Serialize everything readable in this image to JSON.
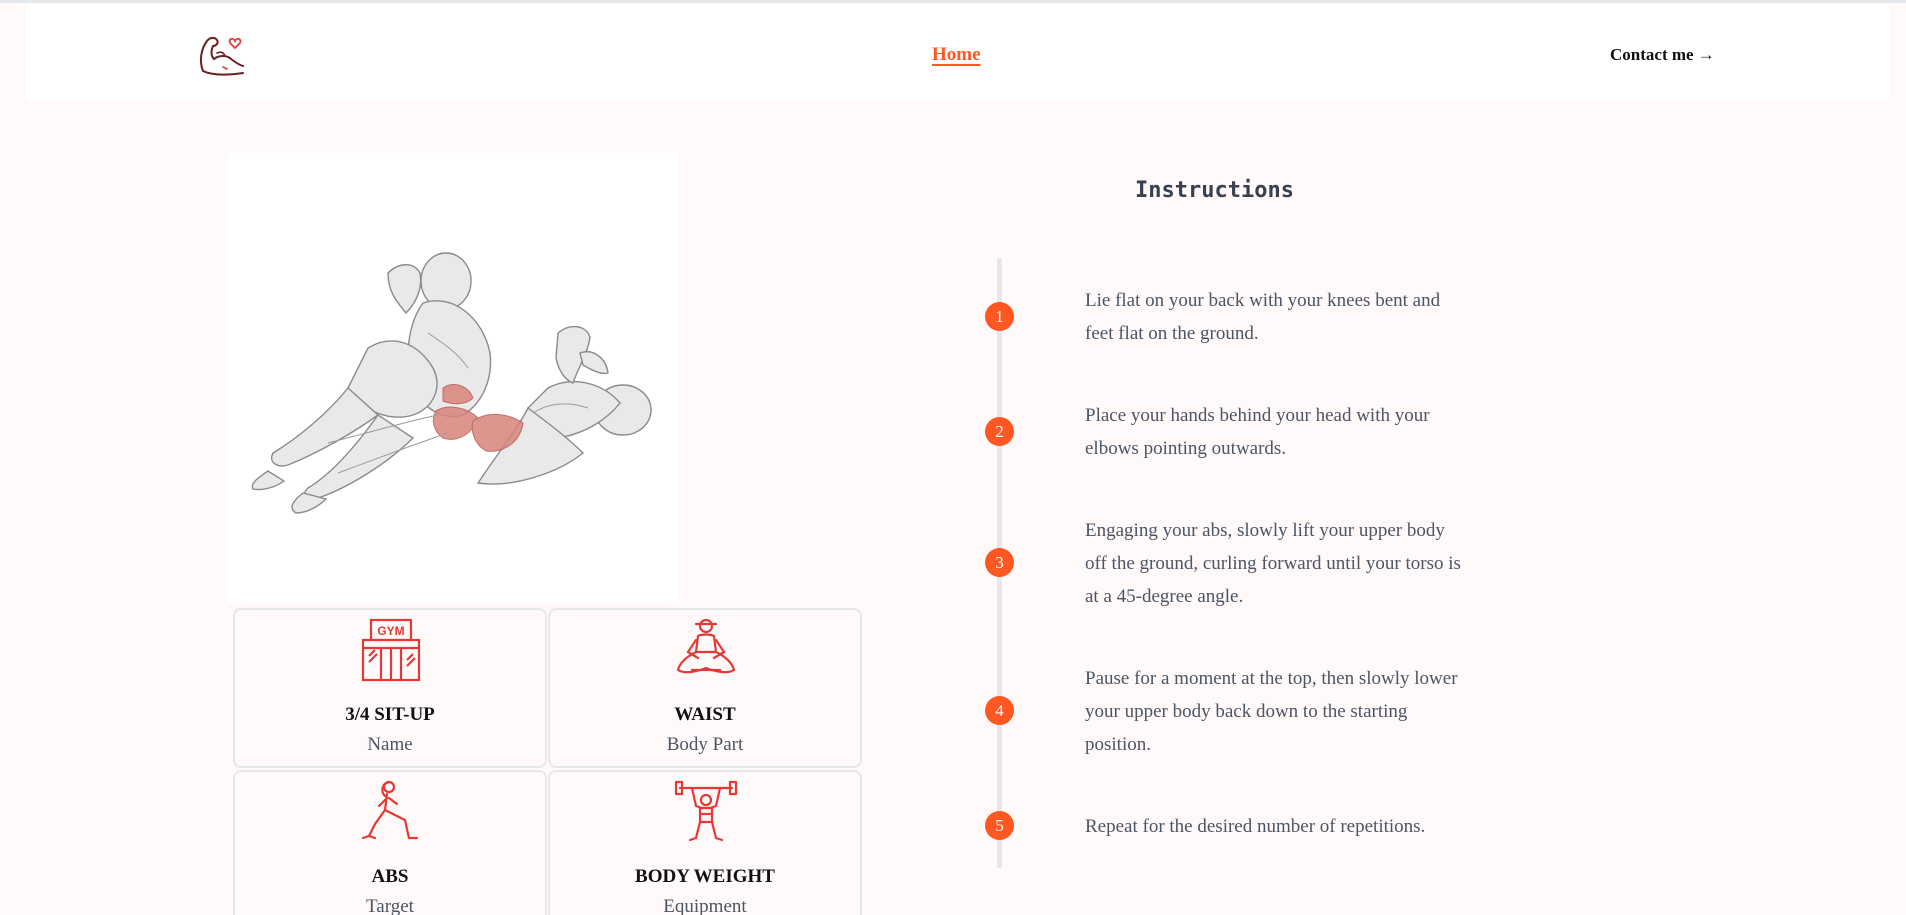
{
  "header": {
    "logo_name": "flexed-arm-heart-icon",
    "nav_home": "Home",
    "nav_contact": "Contact me →"
  },
  "exercise": {
    "image_alt": "3/4 sit-up exercise illustration",
    "details": [
      {
        "value": "3/4 SIT-UP",
        "label": "Name",
        "icon": "gym-icon"
      },
      {
        "value": "WAIST",
        "label": "Body Part",
        "icon": "meditation-icon"
      },
      {
        "value": "ABS",
        "label": "Target",
        "icon": "lunge-icon"
      },
      {
        "value": "BODY WEIGHT",
        "label": "Equipment",
        "icon": "weightlifter-icon"
      }
    ]
  },
  "instructions": {
    "title": "Instructions",
    "steps": [
      {
        "number": "1",
        "text": "Lie flat on your back with your knees bent and feet flat on the ground."
      },
      {
        "number": "2",
        "text": "Place your hands behind your head with your elbows pointing outwards."
      },
      {
        "number": "3",
        "text": "Engaging your abs, slowly lift your upper body off the ground, curling forward until your torso is at a 45-degree angle."
      },
      {
        "number": "4",
        "text": "Pause for a moment at the top, then slowly lower your upper body back down to the starting position."
      },
      {
        "number": "5",
        "text": "Repeat for the desired number of repetitions."
      }
    ]
  },
  "colors": {
    "accent": "#ff5722",
    "icon_red": "#e53935",
    "page_bg": "#fff9fa"
  }
}
